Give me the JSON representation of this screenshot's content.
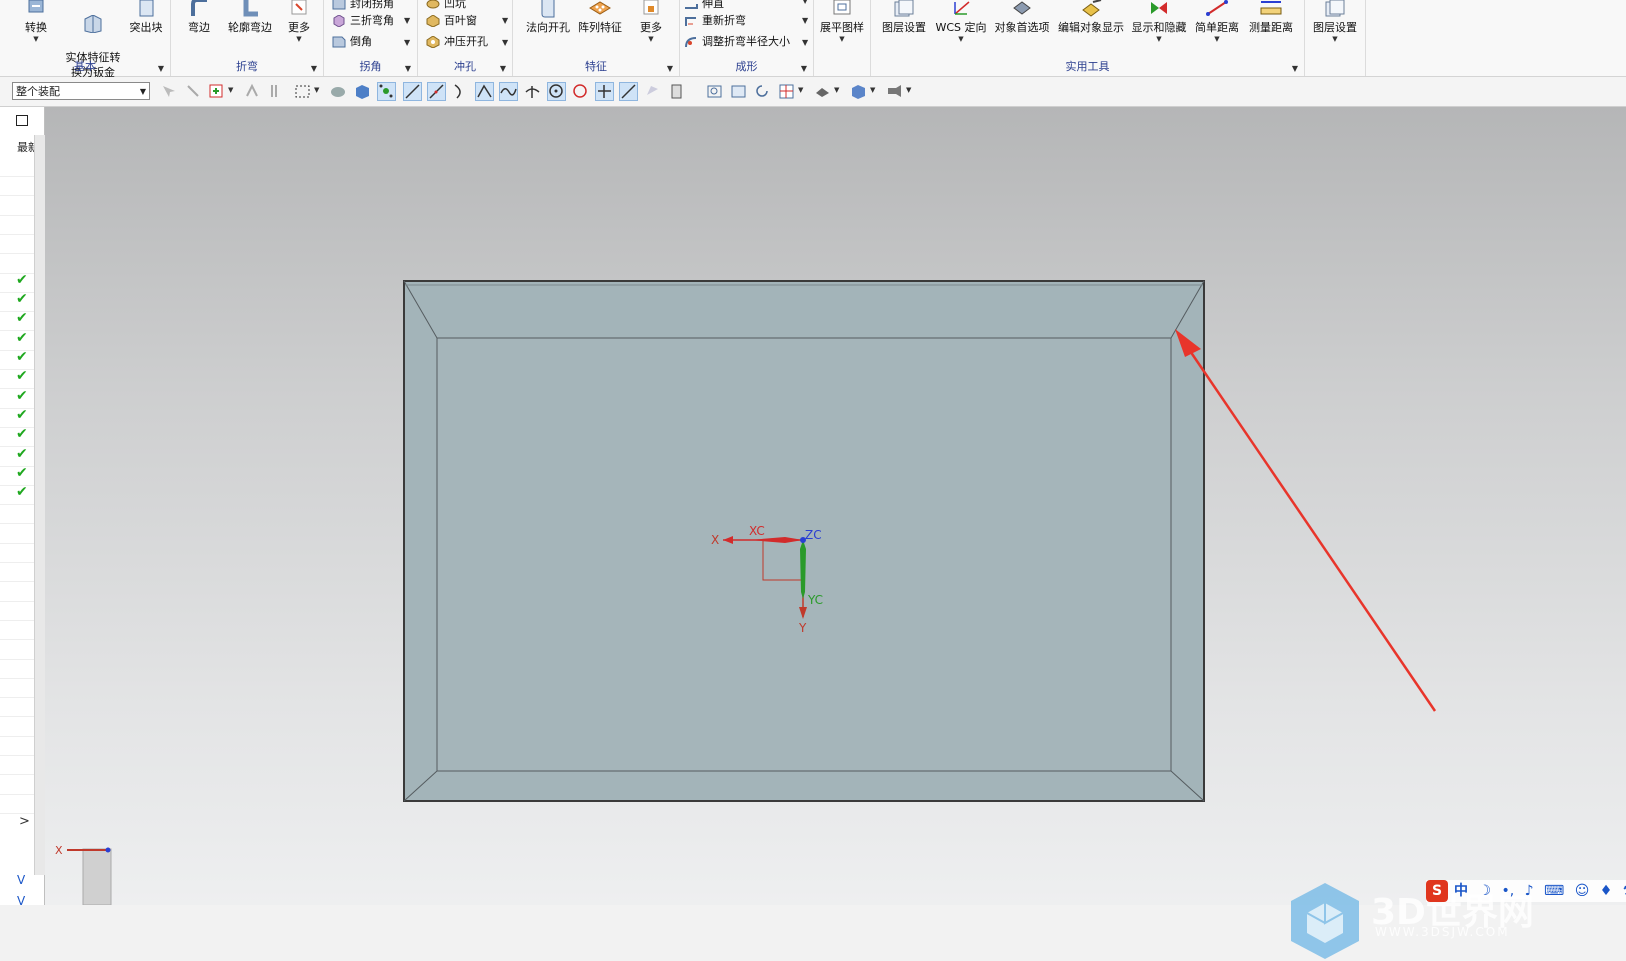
{
  "ribbon": {
    "groups": [
      {
        "label": "基本",
        "buttons": [
          {
            "label": "转换",
            "has_dropdown": true,
            "icon": "convert-icon"
          },
          {
            "label": "实体特征转\n换为钣金",
            "icon": "solid-to-sheetmetal-icon"
          },
          {
            "label": "突出块",
            "icon": "tab-block-icon"
          }
        ]
      },
      {
        "label": "折弯",
        "buttons": [
          {
            "label": "弯边",
            "icon": "flange-icon"
          },
          {
            "label": "轮廓弯边",
            "icon": "contour-flange-icon"
          },
          {
            "label": "更多",
            "has_dropdown": true,
            "icon": "more-icon"
          }
        ]
      },
      {
        "label": "拐角",
        "rows": [
          {
            "label": "封闭拐角",
            "icon": "closed-corner-icon"
          },
          {
            "label": "三折弯角",
            "icon": "three-bend-corner-icon"
          },
          {
            "label": "倒角",
            "icon": "chamfer-icon"
          }
        ]
      },
      {
        "label": "冲孔",
        "rows": [
          {
            "label": "凹坑",
            "icon": "dimple-icon"
          },
          {
            "label": "百叶窗",
            "icon": "louver-icon"
          },
          {
            "label": "冲压开孔",
            "icon": "drawn-cutout-icon"
          }
        ]
      },
      {
        "label": "特征",
        "buttons": [
          {
            "label": "法向开孔",
            "icon": "normal-cutout-icon"
          },
          {
            "label": "阵列特征",
            "icon": "pattern-feature-icon"
          },
          {
            "label": "更多",
            "has_dropdown": true,
            "icon": "more-icon"
          }
        ]
      },
      {
        "label": "成形",
        "rows": [
          {
            "label": "伸直",
            "icon": "unbend-icon"
          },
          {
            "label": "重新折弯",
            "icon": "rebend-icon"
          },
          {
            "label": "调整折弯半径大小",
            "icon": "resize-bend-radius-icon"
          }
        ]
      },
      {
        "label": "",
        "buttons": [
          {
            "label": "展平图样",
            "has_dropdown": true,
            "icon": "flat-pattern-icon"
          }
        ]
      },
      {
        "label": "实用工具",
        "buttons": [
          {
            "label": "图层设置",
            "icon": "layer-settings-icon"
          },
          {
            "label": "WCS 定向",
            "has_dropdown": true,
            "icon": "wcs-orient-icon"
          },
          {
            "label": "对象首选项",
            "icon": "object-preferences-icon"
          },
          {
            "label": "编辑对象显示",
            "icon": "edit-object-display-icon"
          },
          {
            "label": "显示和隐藏",
            "has_dropdown": true,
            "icon": "show-hide-icon"
          },
          {
            "label": "简单距离",
            "has_dropdown": true,
            "icon": "simple-distance-icon"
          },
          {
            "label": "测量距离",
            "icon": "measure-distance-icon"
          }
        ]
      },
      {
        "label": "",
        "buttons": [
          {
            "label": "图层设置",
            "has_dropdown": true,
            "icon": "layer-settings-icon"
          }
        ]
      }
    ]
  },
  "toolbar": {
    "selection_scope": "整个装配"
  },
  "navigator": {
    "column_header": "最新",
    "checked_rows": 12,
    "expand_right": ">",
    "expand_down": "V"
  },
  "viewport": {
    "csys_labels": {
      "x": "X",
      "xc": "XC",
      "zc": "ZC",
      "yc": "YC",
      "y": "Y"
    },
    "mini_triad_label": "X",
    "colors": {
      "part_face": "#a3b4b9",
      "arrow": "#e8352b",
      "xc": "#d22b2b",
      "yc": "#2a9a2a",
      "zc": "#2a3fd2"
    }
  },
  "watermark": {
    "text": "3D世界网",
    "url_text": "WWW.3DSJW.COM"
  },
  "ime_bar": {
    "logo": "S",
    "mode": "中"
  }
}
